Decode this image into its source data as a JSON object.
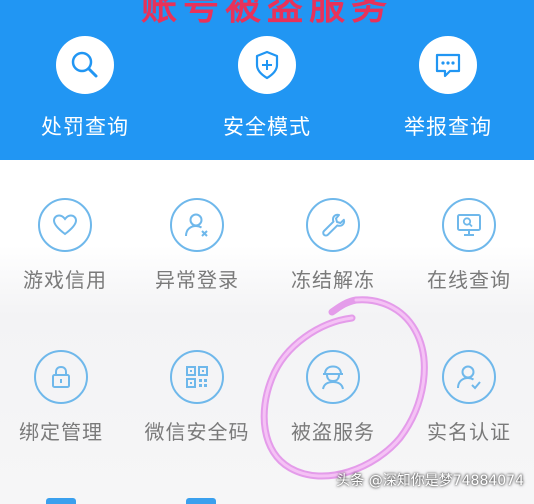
{
  "banner": {
    "title": "账号被盗服务"
  },
  "top_actions": [
    {
      "label": "处罚查询",
      "icon": "search-icon"
    },
    {
      "label": "安全模式",
      "icon": "shield-plus-icon"
    },
    {
      "label": "举报查询",
      "icon": "report-chat-icon"
    }
  ],
  "grid": {
    "row1": [
      {
        "label": "游戏信用",
        "icon": "heart-icon"
      },
      {
        "label": "异常登录",
        "icon": "user-x-icon"
      },
      {
        "label": "冻结解冻",
        "icon": "wrench-icon"
      },
      {
        "label": "在线查询",
        "icon": "monitor-search-icon"
      }
    ],
    "row2": [
      {
        "label": "绑定管理",
        "icon": "lock-icon"
      },
      {
        "label": "微信安全码",
        "icon": "qr-code-icon"
      },
      {
        "label": "被盗服务",
        "icon": "thief-icon"
      },
      {
        "label": "实名认证",
        "icon": "user-check-icon"
      }
    ]
  },
  "watermark": "头条 @深知你是梦74884074",
  "colors": {
    "banner_blue": "#2196f3",
    "icon_ring": "#6fb8eb",
    "label_gray": "#7a7a7a",
    "annotation_pink": "#e08ce8"
  }
}
